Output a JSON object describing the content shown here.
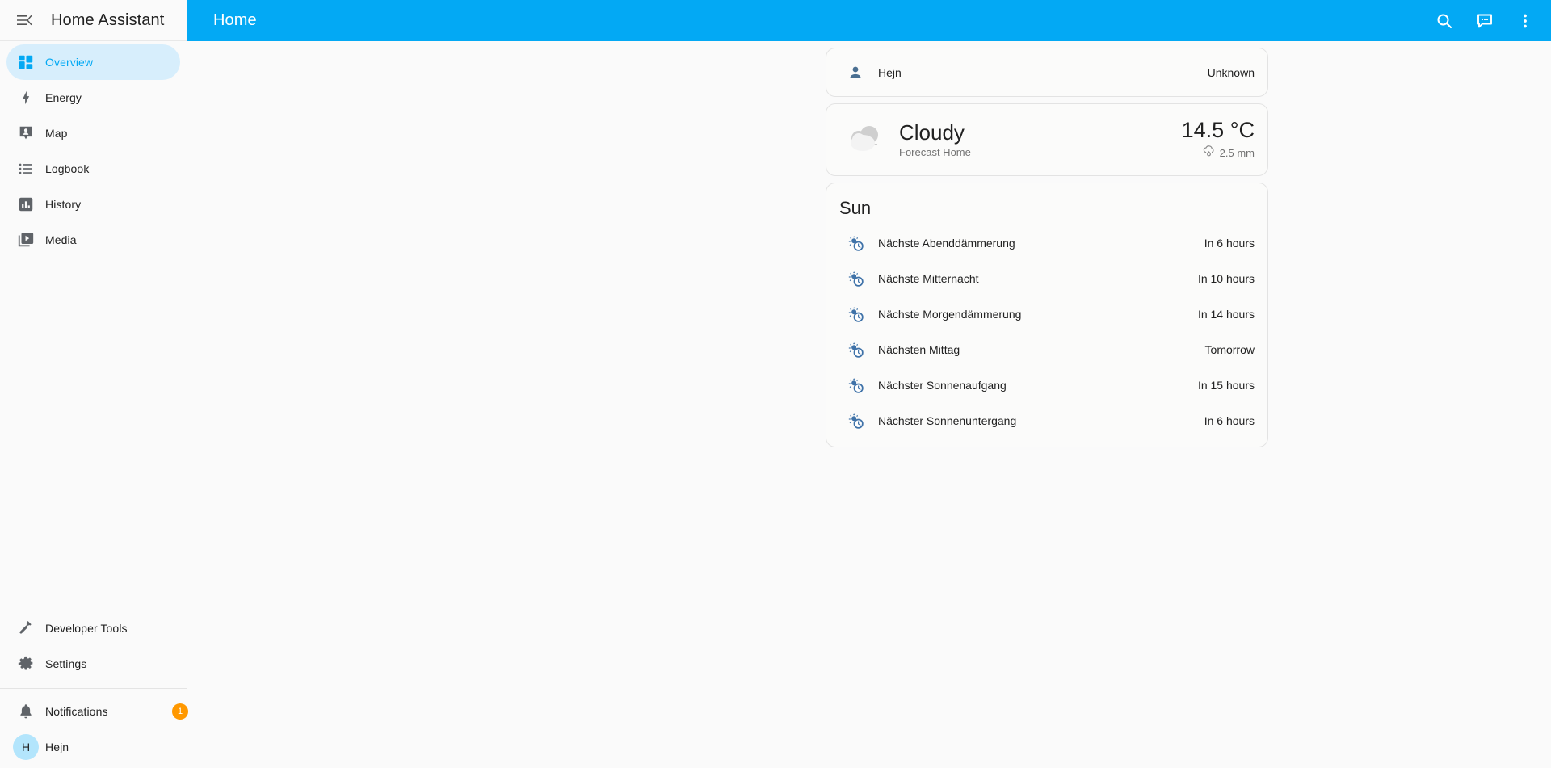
{
  "sidebar": {
    "title": "Home Assistant",
    "menu_icon": "collapse-menu-icon",
    "nav": [
      {
        "label": "Overview",
        "icon": "view-dashboard-icon",
        "active": true
      },
      {
        "label": "Energy",
        "icon": "lightning-bolt-icon",
        "active": false
      },
      {
        "label": "Map",
        "icon": "map-marker-account-icon",
        "active": false
      },
      {
        "label": "Logbook",
        "icon": "format-list-bulleted-icon",
        "active": false
      },
      {
        "label": "History",
        "icon": "chart-box-icon",
        "active": false
      },
      {
        "label": "Media",
        "icon": "play-box-multiple-icon",
        "active": false
      }
    ],
    "bottom": [
      {
        "label": "Developer Tools",
        "icon": "hammer-wrench-icon"
      },
      {
        "label": "Settings",
        "icon": "cog-icon"
      }
    ],
    "notifications": {
      "label": "Notifications",
      "icon": "bell-icon",
      "badge": "1",
      "badge_color": "#ff9800"
    },
    "user": {
      "name": "Hejn",
      "initial": "H",
      "avatar_color": "#b3e5fc"
    }
  },
  "appbar": {
    "title": "Home",
    "background": "#03a9f4",
    "actions": [
      {
        "name": "search-icon",
        "label": "Search"
      },
      {
        "name": "assist-icon",
        "label": "Assist"
      },
      {
        "name": "overflow-menu-icon",
        "label": "More options"
      }
    ]
  },
  "cards": {
    "person": {
      "icon": "account-icon",
      "name": "Hejn",
      "state": "Unknown"
    },
    "weather": {
      "icon": "weather-cloudy-icon",
      "condition": "Cloudy",
      "subtitle": "Forecast Home",
      "temperature": "14.5 °C",
      "precipitation": "2.5 mm",
      "precipitation_icon": "weather-pouring-icon"
    },
    "sun": {
      "title": "Sun",
      "rows": [
        {
          "icon": "sun-clock-icon",
          "name": "Nächste Abenddämmerung",
          "state": "In 6 hours"
        },
        {
          "icon": "sun-clock-icon",
          "name": "Nächste Mitternacht",
          "state": "In 10 hours"
        },
        {
          "icon": "sun-clock-icon",
          "name": "Nächste Morgendämmerung",
          "state": "In 14 hours"
        },
        {
          "icon": "sun-clock-icon",
          "name": "Nächsten Mittag",
          "state": "Tomorrow"
        },
        {
          "icon": "sun-clock-icon",
          "name": "Nächster Sonnenaufgang",
          "state": "In 15 hours"
        },
        {
          "icon": "sun-clock-icon",
          "name": "Nächster Sonnenuntergang",
          "state": "In 6 hours"
        }
      ]
    }
  }
}
